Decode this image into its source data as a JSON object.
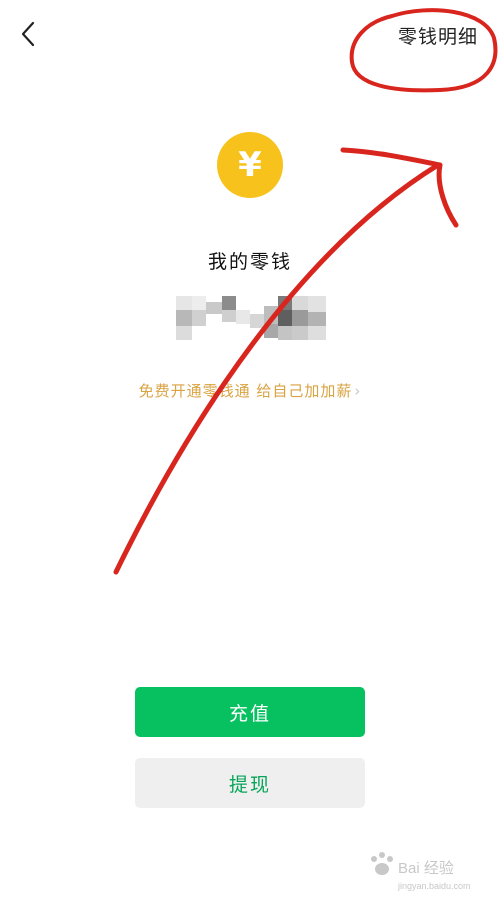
{
  "header": {
    "back_icon": "chevron-left-icon",
    "detail_link_label": "零钱明细"
  },
  "wallet": {
    "coin_icon": "yuan-coin-icon",
    "coin_symbol": "¥",
    "title": "我的零钱",
    "promo_text": "免费开通零钱通 给自己加加薪",
    "promo_chevron": "›"
  },
  "actions": {
    "recharge_label": "充值",
    "withdraw_label": "提现"
  },
  "colors": {
    "coin": "#f6c21b",
    "primary_green": "#07c160",
    "promo_gold": "#d9a342",
    "annotation_red": "#d8261f"
  },
  "watermark": {
    "line1": "Bai 经验",
    "line2": "jingyan.baidu.com"
  }
}
